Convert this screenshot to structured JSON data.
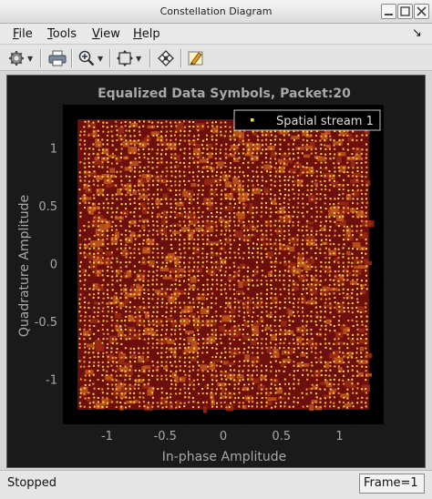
{
  "window": {
    "title": "Constellation Diagram"
  },
  "menu": {
    "file": {
      "first": "F",
      "rest": "ile"
    },
    "tools": {
      "first": "T",
      "rest": "ools"
    },
    "view": {
      "first": "V",
      "rest": "iew"
    },
    "help": {
      "first": "H",
      "rest": "elp"
    },
    "dock_glyph": "↘"
  },
  "toolbar": {
    "icons": [
      "gear-icon",
      "print-icon",
      "zoom-in-icon",
      "fit-axes-icon",
      "autoscale-icon",
      "highlight-icon"
    ]
  },
  "plot": {
    "title": "Equalized Data Symbols, Packet:20",
    "xlabel": "In-phase Amplitude",
    "ylabel": "Quadrature Amplitude",
    "xticks": [
      "-1",
      "-0.5",
      "0",
      "0.5",
      "1"
    ],
    "yticks": [
      "1",
      "0.5",
      "0",
      "-0.5",
      "-1"
    ],
    "legend": "Spatial stream 1"
  },
  "chart_data": {
    "type": "scatter",
    "title": "Equalized Data Symbols, Packet:20",
    "xlabel": "In-phase Amplitude",
    "ylabel": "Quadrature Amplitude",
    "xlim": [
      -1.38,
      1.38
    ],
    "ylim": [
      -1.38,
      1.38
    ],
    "grid": false,
    "legend_position": "top-right",
    "series": [
      {
        "name": "Spatial stream 1",
        "marker_color": "#ffd84a",
        "constellation": "dense square QAM grid",
        "points_per_axis": 64,
        "i_range": [
          -1.23,
          1.23
        ],
        "q_range": [
          -1.23,
          1.23
        ]
      }
    ],
    "colors": {
      "background": "#000000",
      "panel": "#1a1a1a",
      "text": "#a8a8a8",
      "accent": "#c0392b",
      "point": "#ffd84a",
      "trail": "#6e0f0f"
    }
  },
  "status": {
    "text": "Stopped",
    "frame": "Frame=1"
  }
}
